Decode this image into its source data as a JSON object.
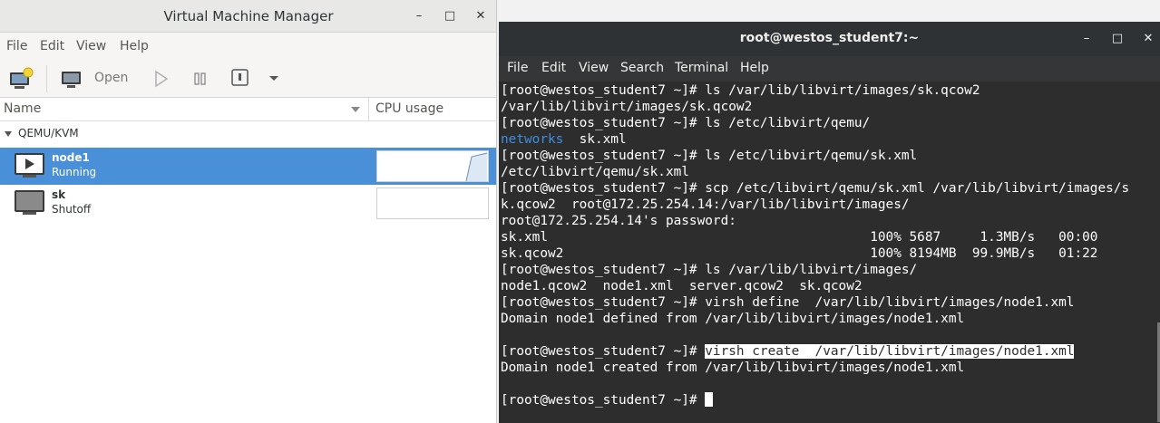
{
  "vmm": {
    "title": "Virtual Machine Manager",
    "menu": [
      "File",
      "Edit",
      "View",
      "Help"
    ],
    "toolbar": {
      "open_label": "Open"
    },
    "columns": {
      "name": "Name",
      "cpu": "CPU usage"
    },
    "group": "QEMU/KVM",
    "vms": [
      {
        "name": "node1",
        "status": "Running"
      },
      {
        "name": "sk",
        "status": "Shutoff"
      }
    ]
  },
  "terminal": {
    "title": "root@westos_student7:~",
    "menu": [
      "File",
      "Edit",
      "View",
      "Search",
      "Terminal",
      "Help"
    ],
    "lines": [
      "[root@westos_student7 ~]# ls /var/lib/libvirt/images/sk.qcow2",
      "/var/lib/libvirt/images/sk.qcow2",
      "[root@westos_student7 ~]# ls /etc/libvirt/qemu/",
      "",
      "[root@westos_student7 ~]# ls /etc/libvirt/qemu/sk.xml",
      "/etc/libvirt/qemu/sk.xml",
      "[root@westos_student7 ~]# scp /etc/libvirt/qemu/sk.xml /var/lib/libvirt/images/s",
      "k.qcow2  root@172.25.254.14:/var/lib/libvirt/images/",
      "root@172.25.254.14's password:",
      "sk.xml                                         100% 5687     1.3MB/s   00:00",
      "sk.qcow2                                       100% 8194MB  99.9MB/s   01:22",
      "[root@westos_student7 ~]# ls /var/lib/libvirt/images/",
      "node1.qcow2  node1.xml  server.qcow2  sk.qcow2",
      "[root@westos_student7 ~]# virsh define  /var/lib/libvirt/images/node1.xml",
      "Domain node1 defined from /var/lib/libvirt/images/node1.xml",
      "",
      "",
      "Domain node1 created from /var/lib/libvirt/images/node1.xml",
      "",
      ""
    ],
    "dir_listing": {
      "dir": "networks",
      "file": "  sk.xml"
    },
    "create_prompt": "[root@westos_student7 ~]# ",
    "create_command": "virsh create  /var/lib/libvirt/images/node1.xml",
    "final_prompt": "[root@westos_student7 ~]# "
  },
  "colors": {
    "selection": "#4a90d9",
    "terminal_bg": "#2d2d2d",
    "directory": "#3d8fe0"
  }
}
